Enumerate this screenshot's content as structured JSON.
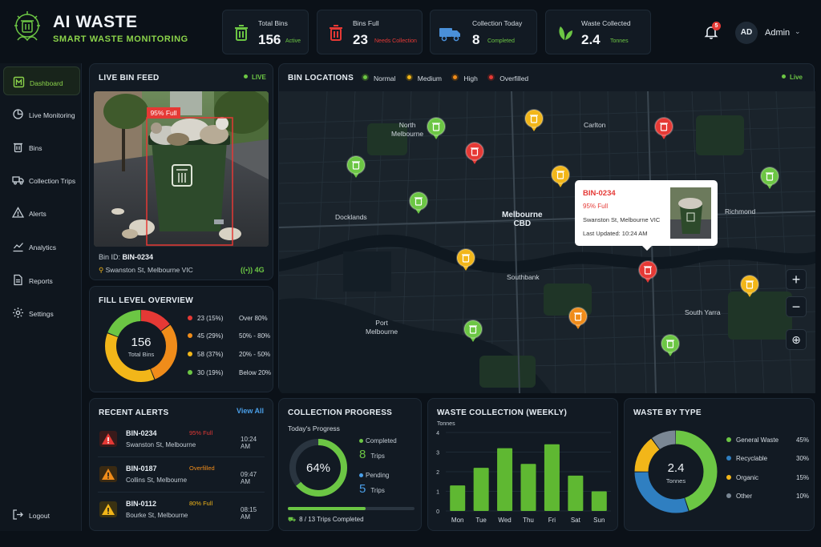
{
  "header": {
    "brand": "AI WASTE",
    "subtitle": "SMART WASTE MONITORING",
    "notifications": "5",
    "avatar": "AD",
    "user": "Admin",
    "stats": [
      {
        "label": "Total Bins",
        "value": "156",
        "tag": "Active",
        "icon": "trash-icon",
        "color": "#6cc644"
      },
      {
        "label": "Bins Full",
        "value": "23",
        "tag": "Needs Collection",
        "icon": "trash-icon",
        "color": "#e53935"
      },
      {
        "label": "Collection Today",
        "value": "8",
        "tag": "Completed",
        "icon": "truck-icon",
        "color": "#4a90d9"
      },
      {
        "label": "Waste Collected",
        "value": "2.4",
        "tag": "Tonnes",
        "icon": "leaf-icon",
        "color": "#6cc644"
      }
    ]
  },
  "sidebar": {
    "items": [
      {
        "label": "Dashboard",
        "icon": "dashboard-icon",
        "active": true
      },
      {
        "label": "Live Monitoring",
        "icon": "monitor-icon"
      },
      {
        "label": "Bins",
        "icon": "trash-icon"
      },
      {
        "label": "Collection Trips",
        "icon": "truck-icon"
      },
      {
        "label": "Alerts",
        "icon": "alert-icon"
      },
      {
        "label": "Analytics",
        "icon": "analytics-icon"
      },
      {
        "label": "Reports",
        "icon": "report-icon"
      },
      {
        "label": "Settings",
        "icon": "gear-icon"
      }
    ],
    "logout": "Logout"
  },
  "feed": {
    "title": "LIVE BIN FEED",
    "live": "LIVE",
    "overlay": "95% Full",
    "bin_id_label": "Bin ID:",
    "bin_id": "BIN-0234",
    "location": "Swanston St, Melbourne VIC",
    "signal": "4G"
  },
  "map": {
    "title": "BIN LOCATIONS",
    "live": "Live",
    "legend": [
      {
        "label": "Normal",
        "color": "#6cc644"
      },
      {
        "label": "Medium",
        "color": "#f2b619"
      },
      {
        "label": "High",
        "color": "#f08c1a"
      },
      {
        "label": "Overfilled",
        "color": "#e53935"
      }
    ],
    "places": [
      {
        "name": "North\nMelbourne"
      },
      {
        "name": "Carlton"
      },
      {
        "name": "Docklands"
      },
      {
        "name": "Melbourne\nCBD"
      },
      {
        "name": "Richmond"
      },
      {
        "name": "Southbank"
      },
      {
        "name": "Port\nMelbourne"
      },
      {
        "name": "South Yarra"
      }
    ],
    "popup": {
      "id": "BIN-0234",
      "fill": "95% Full",
      "location": "Swanston St, Melbourne VIC",
      "updated": "Last Updated: 10:24 AM"
    },
    "zoom_in": "+",
    "zoom_out": "−"
  },
  "fill_level": {
    "title": "FILL LEVEL OVERVIEW",
    "total": "156",
    "total_label": "Total Bins",
    "rows": [
      {
        "count": "23 (15%)",
        "range": "Over 80%",
        "color": "#e53935",
        "pct": 15
      },
      {
        "count": "45 (29%)",
        "range": "50% - 80%",
        "color": "#f08c1a",
        "pct": 29
      },
      {
        "count": "58 (37%)",
        "range": "20% - 50%",
        "color": "#f2b619",
        "pct": 37
      },
      {
        "count": "30 (19%)",
        "range": "Below 20%",
        "color": "#6cc644",
        "pct": 19
      }
    ]
  },
  "alerts": {
    "title": "RECENT ALERTS",
    "view_all": "View All",
    "items": [
      {
        "id": "BIN-0234",
        "location": "Swanston St, Melbourne",
        "status": "95% Full",
        "time": "10:24 AM",
        "color": "#e53935"
      },
      {
        "id": "BIN-0187",
        "location": "Collins St, Melbourne",
        "status": "Overfilled",
        "time": "09:47 AM",
        "color": "#f08c1a"
      },
      {
        "id": "BIN-0112",
        "location": "Bourke St, Melbourne",
        "status": "80% Full",
        "time": "08:15 AM",
        "color": "#f2b619"
      }
    ]
  },
  "collection": {
    "title": "COLLECTION PROGRESS",
    "subtitle": "Today's Progress",
    "percent": "64%",
    "percent_value": 64,
    "completed_label": "Completed",
    "completed": "8",
    "pending_label": "Pending",
    "pending": "5",
    "trips_unit": "Trips",
    "bar_value": 0.615,
    "footer": "8 / 13 Trips Completed"
  },
  "weekly": {
    "title": "WASTE COLLECTION (WEEKLY)",
    "unit": "Tonnes"
  },
  "chart_data": {
    "type": "bar",
    "title": "WASTE COLLECTION (WEEKLY)",
    "ylabel": "Tonnes",
    "categories": [
      "Mon",
      "Tue",
      "Wed",
      "Thu",
      "Fri",
      "Sat",
      "Sun"
    ],
    "values": [
      1.3,
      2.2,
      3.2,
      2.4,
      3.4,
      1.8,
      1.0
    ],
    "yticks": [
      "0",
      "1",
      "2",
      "3",
      "4"
    ],
    "ylim": [
      0,
      4
    ],
    "color": "#5fb832"
  },
  "waste_type": {
    "title": "WASTE BY TYPE",
    "total": "2.4",
    "unit": "Tonnes",
    "rows": [
      {
        "label": "General Waste",
        "pct": "45%",
        "value": 45,
        "color": "#6cc644"
      },
      {
        "label": "Recyclable",
        "pct": "30%",
        "value": 30,
        "color": "#2f7fc1"
      },
      {
        "label": "Organic",
        "pct": "15%",
        "value": 15,
        "color": "#f2b619"
      },
      {
        "label": "Other",
        "pct": "10%",
        "value": 10,
        "color": "#7a8794"
      }
    ]
  }
}
